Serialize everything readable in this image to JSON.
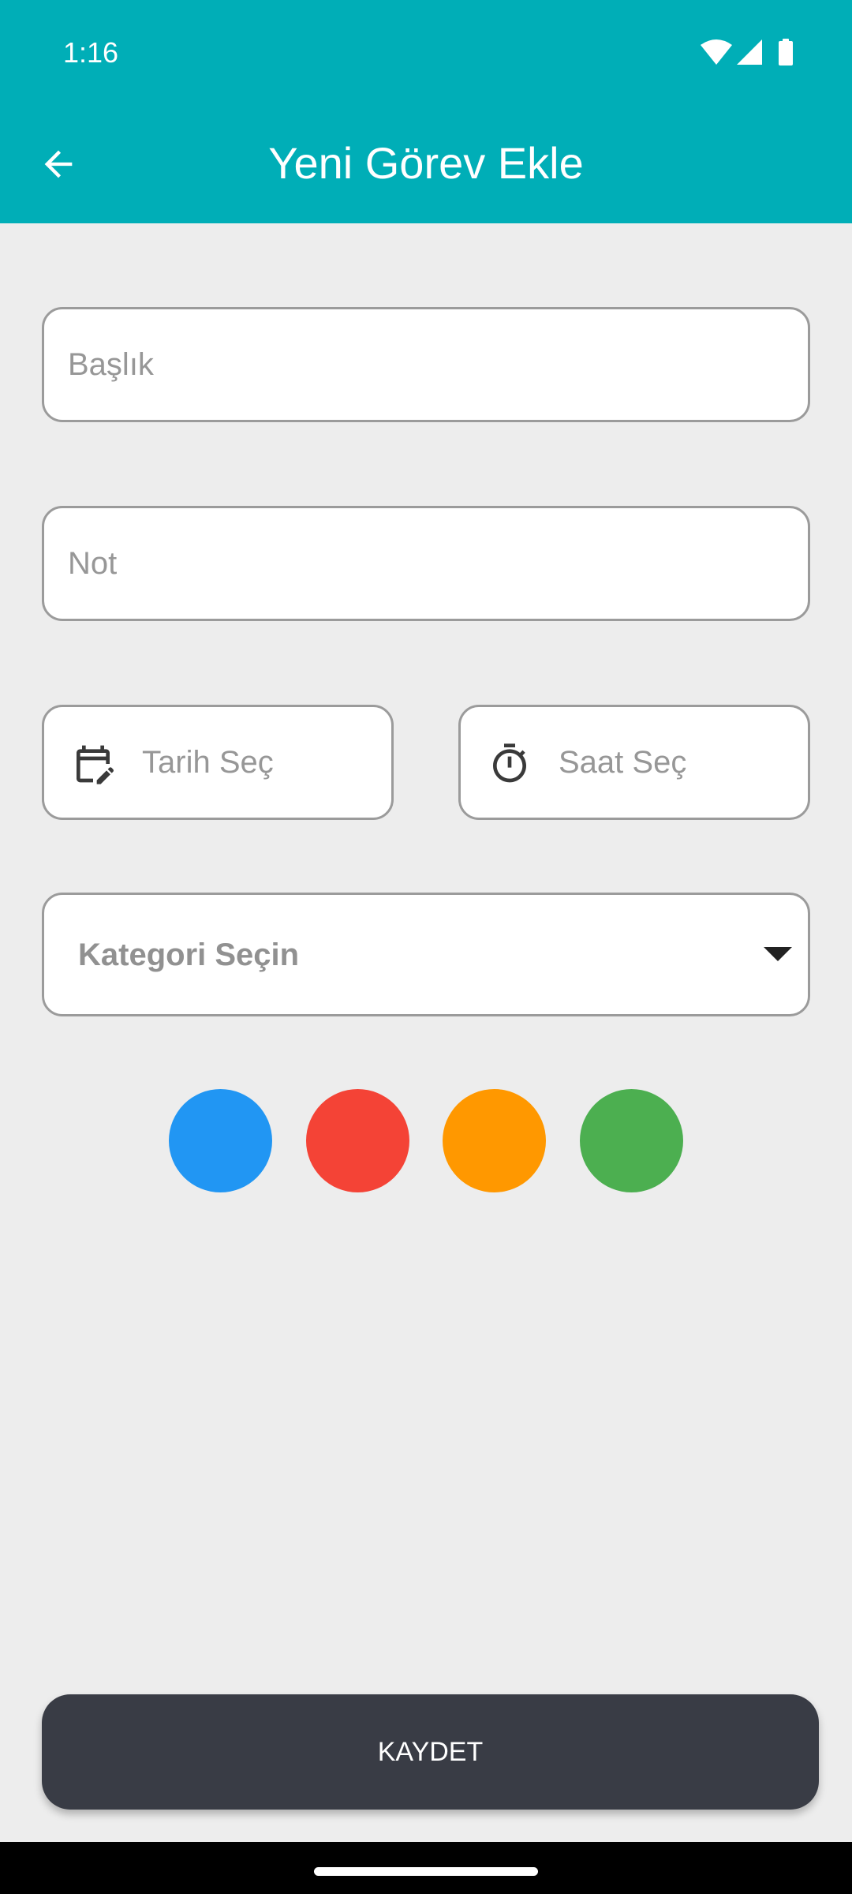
{
  "status_bar": {
    "time": "1:16",
    "icons": [
      "wifi-icon",
      "cellular-signal-icon",
      "battery-icon"
    ]
  },
  "header": {
    "back_icon": "arrow-back-icon",
    "title": "Yeni Görev Ekle",
    "background": "#00AEB7"
  },
  "form": {
    "title_field": {
      "placeholder": "Başlık",
      "value": ""
    },
    "note_field": {
      "placeholder": "Not",
      "value": ""
    },
    "date_field": {
      "placeholder": "Tarih Seç",
      "value": "",
      "icon": "calendar-edit-icon"
    },
    "time_field": {
      "placeholder": "Saat Seç",
      "value": "",
      "icon": "timer-icon"
    },
    "category_dropdown": {
      "label": "Kategori Seçin",
      "icon": "dropdown-arrow-icon"
    },
    "colors": [
      {
        "name": "blue",
        "hex": "#2196F3"
      },
      {
        "name": "red",
        "hex": "#F44336"
      },
      {
        "name": "orange",
        "hex": "#FF9800"
      },
      {
        "name": "green",
        "hex": "#4CAF50"
      }
    ]
  },
  "actions": {
    "save_label": "KAYDET",
    "save_background": "#393C45"
  }
}
